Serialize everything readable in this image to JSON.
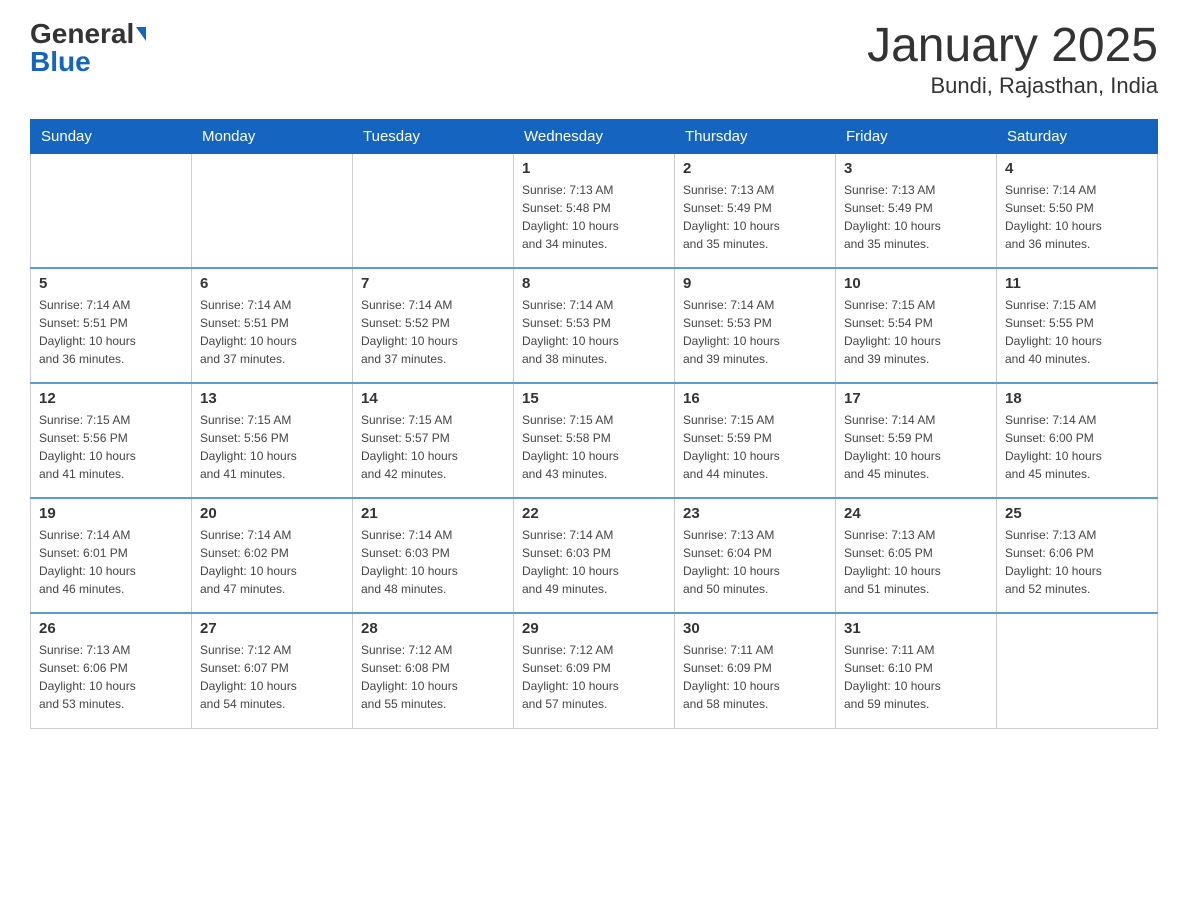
{
  "header": {
    "logo_general": "General",
    "logo_blue": "Blue",
    "title": "January 2025",
    "subtitle": "Bundi, Rajasthan, India"
  },
  "days_of_week": [
    "Sunday",
    "Monday",
    "Tuesday",
    "Wednesday",
    "Thursday",
    "Friday",
    "Saturday"
  ],
  "weeks": [
    [
      {
        "day": "",
        "info": ""
      },
      {
        "day": "",
        "info": ""
      },
      {
        "day": "",
        "info": ""
      },
      {
        "day": "1",
        "info": "Sunrise: 7:13 AM\nSunset: 5:48 PM\nDaylight: 10 hours\nand 34 minutes."
      },
      {
        "day": "2",
        "info": "Sunrise: 7:13 AM\nSunset: 5:49 PM\nDaylight: 10 hours\nand 35 minutes."
      },
      {
        "day": "3",
        "info": "Sunrise: 7:13 AM\nSunset: 5:49 PM\nDaylight: 10 hours\nand 35 minutes."
      },
      {
        "day": "4",
        "info": "Sunrise: 7:14 AM\nSunset: 5:50 PM\nDaylight: 10 hours\nand 36 minutes."
      }
    ],
    [
      {
        "day": "5",
        "info": "Sunrise: 7:14 AM\nSunset: 5:51 PM\nDaylight: 10 hours\nand 36 minutes."
      },
      {
        "day": "6",
        "info": "Sunrise: 7:14 AM\nSunset: 5:51 PM\nDaylight: 10 hours\nand 37 minutes."
      },
      {
        "day": "7",
        "info": "Sunrise: 7:14 AM\nSunset: 5:52 PM\nDaylight: 10 hours\nand 37 minutes."
      },
      {
        "day": "8",
        "info": "Sunrise: 7:14 AM\nSunset: 5:53 PM\nDaylight: 10 hours\nand 38 minutes."
      },
      {
        "day": "9",
        "info": "Sunrise: 7:14 AM\nSunset: 5:53 PM\nDaylight: 10 hours\nand 39 minutes."
      },
      {
        "day": "10",
        "info": "Sunrise: 7:15 AM\nSunset: 5:54 PM\nDaylight: 10 hours\nand 39 minutes."
      },
      {
        "day": "11",
        "info": "Sunrise: 7:15 AM\nSunset: 5:55 PM\nDaylight: 10 hours\nand 40 minutes."
      }
    ],
    [
      {
        "day": "12",
        "info": "Sunrise: 7:15 AM\nSunset: 5:56 PM\nDaylight: 10 hours\nand 41 minutes."
      },
      {
        "day": "13",
        "info": "Sunrise: 7:15 AM\nSunset: 5:56 PM\nDaylight: 10 hours\nand 41 minutes."
      },
      {
        "day": "14",
        "info": "Sunrise: 7:15 AM\nSunset: 5:57 PM\nDaylight: 10 hours\nand 42 minutes."
      },
      {
        "day": "15",
        "info": "Sunrise: 7:15 AM\nSunset: 5:58 PM\nDaylight: 10 hours\nand 43 minutes."
      },
      {
        "day": "16",
        "info": "Sunrise: 7:15 AM\nSunset: 5:59 PM\nDaylight: 10 hours\nand 44 minutes."
      },
      {
        "day": "17",
        "info": "Sunrise: 7:14 AM\nSunset: 5:59 PM\nDaylight: 10 hours\nand 45 minutes."
      },
      {
        "day": "18",
        "info": "Sunrise: 7:14 AM\nSunset: 6:00 PM\nDaylight: 10 hours\nand 45 minutes."
      }
    ],
    [
      {
        "day": "19",
        "info": "Sunrise: 7:14 AM\nSunset: 6:01 PM\nDaylight: 10 hours\nand 46 minutes."
      },
      {
        "day": "20",
        "info": "Sunrise: 7:14 AM\nSunset: 6:02 PM\nDaylight: 10 hours\nand 47 minutes."
      },
      {
        "day": "21",
        "info": "Sunrise: 7:14 AM\nSunset: 6:03 PM\nDaylight: 10 hours\nand 48 minutes."
      },
      {
        "day": "22",
        "info": "Sunrise: 7:14 AM\nSunset: 6:03 PM\nDaylight: 10 hours\nand 49 minutes."
      },
      {
        "day": "23",
        "info": "Sunrise: 7:13 AM\nSunset: 6:04 PM\nDaylight: 10 hours\nand 50 minutes."
      },
      {
        "day": "24",
        "info": "Sunrise: 7:13 AM\nSunset: 6:05 PM\nDaylight: 10 hours\nand 51 minutes."
      },
      {
        "day": "25",
        "info": "Sunrise: 7:13 AM\nSunset: 6:06 PM\nDaylight: 10 hours\nand 52 minutes."
      }
    ],
    [
      {
        "day": "26",
        "info": "Sunrise: 7:13 AM\nSunset: 6:06 PM\nDaylight: 10 hours\nand 53 minutes."
      },
      {
        "day": "27",
        "info": "Sunrise: 7:12 AM\nSunset: 6:07 PM\nDaylight: 10 hours\nand 54 minutes."
      },
      {
        "day": "28",
        "info": "Sunrise: 7:12 AM\nSunset: 6:08 PM\nDaylight: 10 hours\nand 55 minutes."
      },
      {
        "day": "29",
        "info": "Sunrise: 7:12 AM\nSunset: 6:09 PM\nDaylight: 10 hours\nand 57 minutes."
      },
      {
        "day": "30",
        "info": "Sunrise: 7:11 AM\nSunset: 6:09 PM\nDaylight: 10 hours\nand 58 minutes."
      },
      {
        "day": "31",
        "info": "Sunrise: 7:11 AM\nSunset: 6:10 PM\nDaylight: 10 hours\nand 59 minutes."
      },
      {
        "day": "",
        "info": ""
      }
    ]
  ]
}
